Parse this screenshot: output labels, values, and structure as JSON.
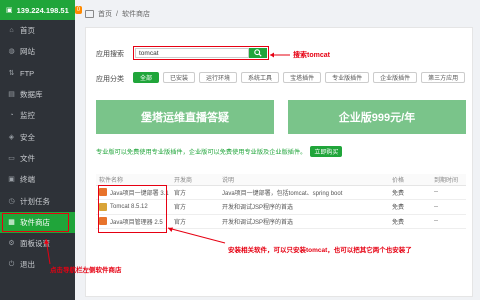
{
  "sidebar": {
    "ip": "139.224.198.51",
    "badge": "0",
    "items": [
      {
        "label": "首页",
        "icon": "home-icon",
        "glyph": "⌂"
      },
      {
        "label": "网站",
        "icon": "globe-icon",
        "glyph": "◍"
      },
      {
        "label": "FTP",
        "icon": "ftp-icon",
        "glyph": "⇅"
      },
      {
        "label": "数据库",
        "icon": "database-icon",
        "glyph": "▤"
      },
      {
        "label": "监控",
        "icon": "monitor-icon",
        "glyph": "◔"
      },
      {
        "label": "安全",
        "icon": "shield-icon",
        "glyph": "◈"
      },
      {
        "label": "文件",
        "icon": "folder-icon",
        "glyph": "▭"
      },
      {
        "label": "终端",
        "icon": "terminal-icon",
        "glyph": "▣"
      },
      {
        "label": "计划任务",
        "icon": "clock-icon",
        "glyph": "◷"
      },
      {
        "label": "软件商店",
        "icon": "store-icon",
        "glyph": "▦"
      },
      {
        "label": "面板设置",
        "icon": "gear-icon",
        "glyph": "⚙"
      },
      {
        "label": "退出",
        "icon": "logout-icon",
        "glyph": "⏻"
      }
    ],
    "active_index": 9
  },
  "breadcrumb": {
    "home": "首页",
    "sep": "/",
    "current": "软件商店"
  },
  "search": {
    "label": "应用搜索",
    "value": "tomcat",
    "annotation": "搜索tomcat"
  },
  "category": {
    "label": "应用分类",
    "items": [
      "全部",
      "已安装",
      "运行环境",
      "系统工具",
      "宝塔插件",
      "专业版插件",
      "企业版插件",
      "第三方应用"
    ]
  },
  "promos": [
    "堡塔运维直播答疑",
    "企业版999元/年"
  ],
  "pro_tip": {
    "text": "专业版可以免费使用专业版插件，企业版可以免费使用专业版及企业版插件。",
    "buy": "立即购买"
  },
  "table": {
    "headers": [
      "软件名称",
      "开发商",
      "说明",
      "价格",
      "到期时间"
    ],
    "rows": [
      {
        "name": "Java项目一键部署 3.1",
        "vendor": "官方",
        "desc": "Java项目一键部署，包括tomcat、spring boot",
        "price": "免费",
        "expire": "--"
      },
      {
        "name": "Tomcat 8.5.12",
        "vendor": "官方",
        "desc": "开发和调试JSP程序的首选",
        "price": "免费",
        "expire": "--"
      },
      {
        "name": "Java项目管理器 2.5",
        "vendor": "官方",
        "desc": "开发和调试JSP程序的首选",
        "price": "免费",
        "expire": "--"
      }
    ]
  },
  "annotations": {
    "install": "安装相关软件，可以只安装tomcat，也可以把其它两个也安装了",
    "store": "点击导航栏左侧软件商店"
  },
  "colors": {
    "accent": "#20a53a",
    "annotation": "#e60012",
    "promo": "#7ac48a"
  }
}
